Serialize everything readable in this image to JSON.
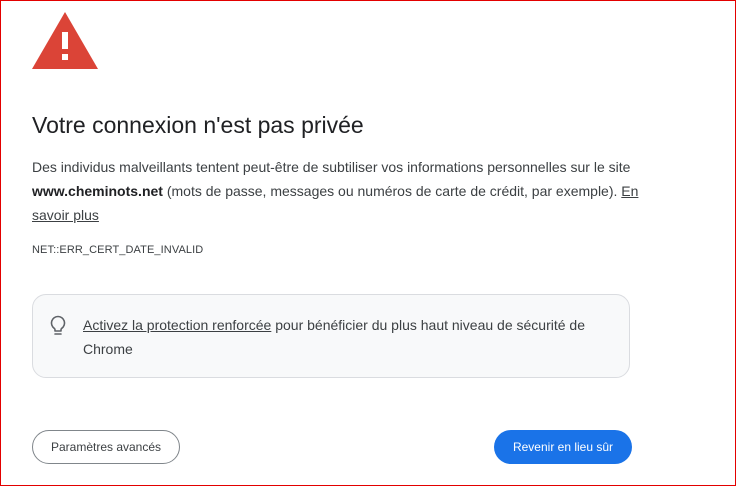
{
  "page": {
    "title": "Votre connexion n'est pas privée",
    "description": {
      "before_site": "Des individus malveillants tentent peut-être de subtiliser vos informations personnelles sur le site ",
      "site": "www.cheminots.net",
      "after_site": " (mots de passe, messages ou numéros de carte de crédit, par exemple). ",
      "learn_more": "En savoir plus"
    },
    "error_code": "NET::ERR_CERT_DATE_INVALID"
  },
  "protection_box": {
    "icon": "lightbulb-icon",
    "link": "Activez la protection renforcée",
    "text": " pour bénéficier du plus haut niveau de sécurité de Chrome"
  },
  "buttons": {
    "advanced": "Paramètres avancés",
    "back_to_safety": "Revenir en lieu sûr"
  },
  "colors": {
    "warning": "#db4437",
    "primary": "#1a73e8",
    "frame_border": "#e30000"
  },
  "icons": {
    "warning": "warning-triangle-icon"
  }
}
